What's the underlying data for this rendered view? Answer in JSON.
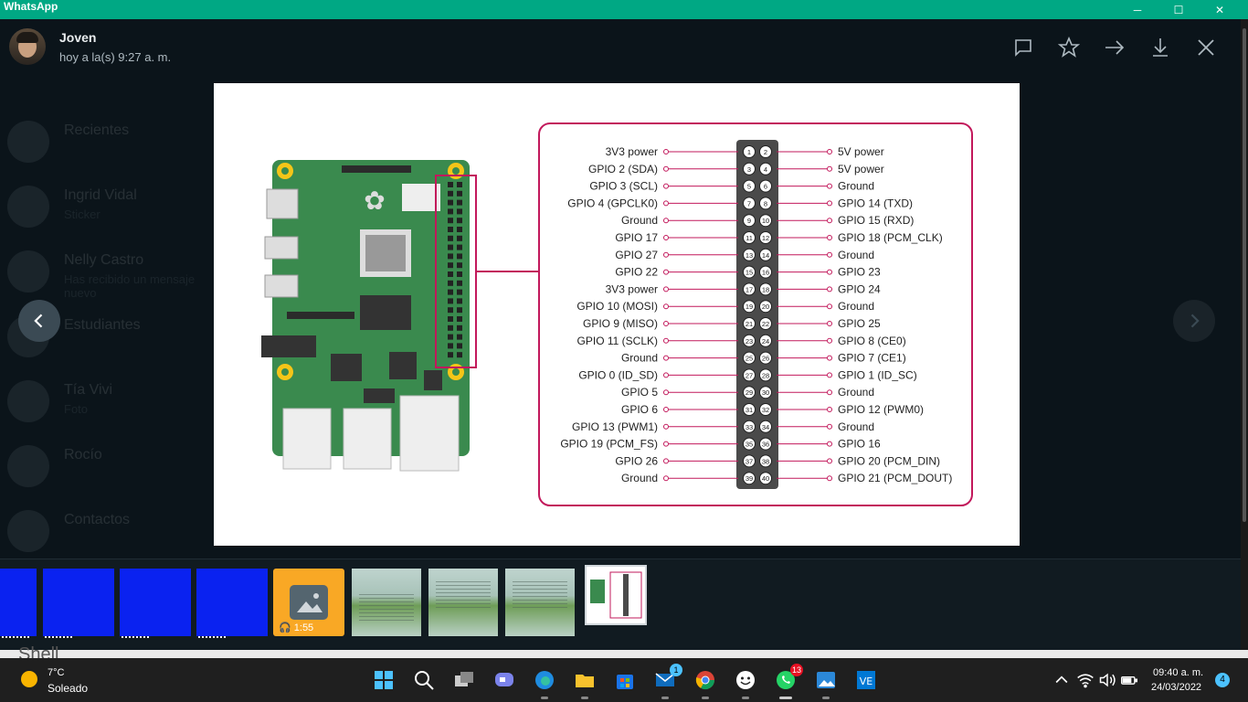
{
  "window": {
    "title": "WhatsApp",
    "minimize": "─",
    "maximize": "☐",
    "close": "✕"
  },
  "header": {
    "contact_name": "Joven",
    "timestamp": "hoy a la(s) 9:27 a. m."
  },
  "background_chats": [
    {
      "name": "Recientes",
      "sub": ""
    },
    {
      "name": "Ingrid Vidal",
      "sub": "Sticker"
    },
    {
      "name": "Nelly Castro",
      "sub": "Has recibido un mensaje nuevo"
    },
    {
      "name": "Estudiantes",
      "sub": ""
    },
    {
      "name": "Tía Vivi",
      "sub": "Foto"
    },
    {
      "name": "Rocío",
      "sub": ""
    },
    {
      "name": "Contactos",
      "sub": ""
    }
  ],
  "diagram": {
    "left_labels": [
      "3V3 power",
      "GPIO 2 (SDA)",
      "GPIO 3 (SCL)",
      "GPIO 4 (GPCLK0)",
      "Ground",
      "GPIO 17",
      "GPIO 27",
      "GPIO 22",
      "3V3 power",
      "GPIO 10 (MOSI)",
      "GPIO 9 (MISO)",
      "GPIO 11 (SCLK)",
      "Ground",
      "GPIO 0 (ID_SD)",
      "GPIO 5",
      "GPIO 6",
      "GPIO 13 (PWM1)",
      "GPIO 19 (PCM_FS)",
      "GPIO 26",
      "Ground"
    ],
    "right_labels": [
      "5V power",
      "5V power",
      "Ground",
      "GPIO 14 (TXD)",
      "GPIO 15 (RXD)",
      "GPIO 18 (PCM_CLK)",
      "Ground",
      "GPIO 23",
      "GPIO 24",
      "Ground",
      "GPIO 25",
      "GPIO 8 (CE0)",
      "GPIO 7 (CE1)",
      "GPIO 1 (ID_SC)",
      "Ground",
      "GPIO 12 (PWM0)",
      "Ground",
      "GPIO 16",
      "GPIO 20 (PCM_DIN)",
      "GPIO 21 (PCM_DOUT)"
    ],
    "pin_numbers_odd": [
      "1",
      "3",
      "5",
      "7",
      "9",
      "11",
      "13",
      "15",
      "17",
      "19",
      "21",
      "23",
      "25",
      "27",
      "29",
      "31",
      "33",
      "35",
      "37",
      "39"
    ],
    "pin_numbers_even": [
      "2",
      "4",
      "6",
      "8",
      "10",
      "12",
      "14",
      "16",
      "18",
      "20",
      "22",
      "24",
      "26",
      "28",
      "30",
      "32",
      "34",
      "36",
      "38",
      "40"
    ],
    "colors": {
      "frame": "#c2185b",
      "board": "#3a8a4e",
      "pinbar": "#4a4a4a"
    }
  },
  "thumbnails": {
    "audio_duration": "1:55"
  },
  "behind_window": {
    "text": "Shell"
  },
  "taskbar": {
    "weather_temp": "7°C",
    "weather_desc": "Soleado",
    "mail_badge": "1",
    "whatsapp_badge": "13",
    "clock_time": "09:40 a. m.",
    "clock_date": "24/03/2022",
    "notification_count": "4"
  }
}
